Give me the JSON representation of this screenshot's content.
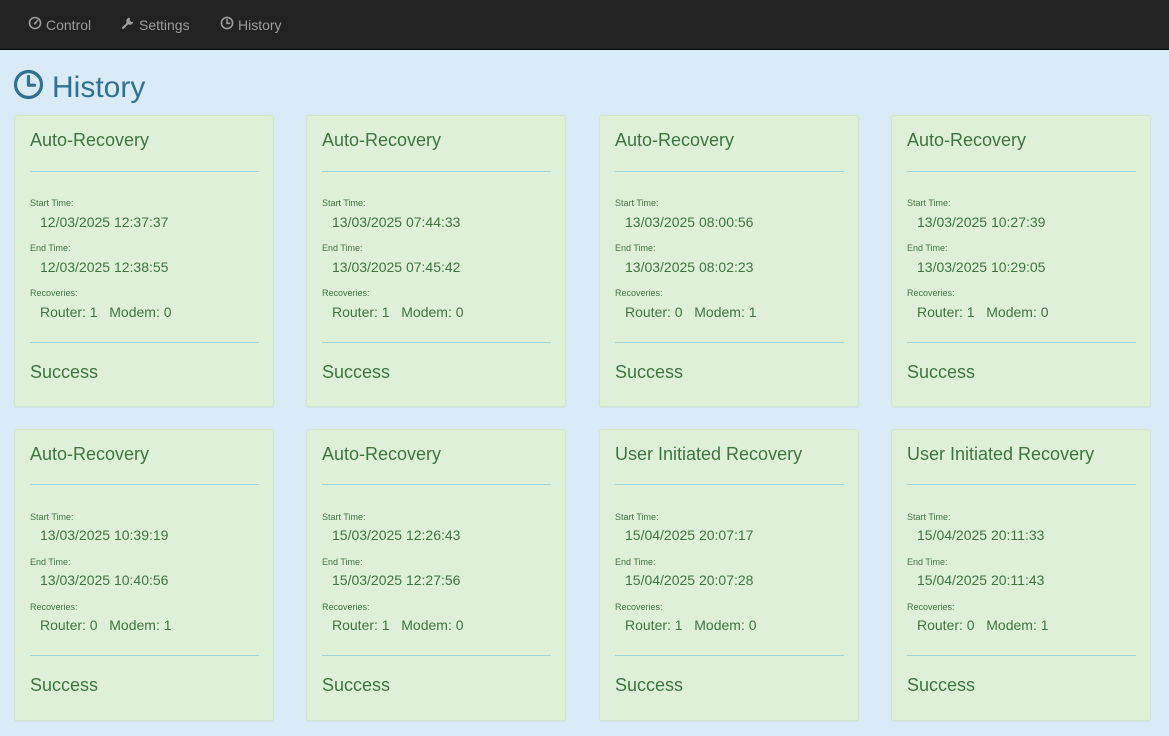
{
  "nav": {
    "items": [
      {
        "label": "Control",
        "icon": "dashboard-icon"
      },
      {
        "label": "Settings",
        "icon": "wrench-icon"
      },
      {
        "label": "History",
        "icon": "clock-icon"
      }
    ]
  },
  "page": {
    "title": "History",
    "title_icon": "clock-icon"
  },
  "labels": {
    "start_time": "Start Time:",
    "end_time": "End Time:",
    "recoveries": "Recoveries:"
  },
  "colors": {
    "navbar_bg": "#222222",
    "nav_text": "#9d9d9d",
    "page_bg": "#d9ebf6",
    "title_color": "#31708f",
    "card_bg": "#dff0d8",
    "card_text": "#3c763d",
    "divider": "#9fd6dc"
  },
  "history": [
    {
      "title": "Auto-Recovery",
      "start": "12/03/2025 12:37:37",
      "end": "12/03/2025 12:38:55",
      "recoveries": "Router: 1   Modem: 0",
      "status": "Success"
    },
    {
      "title": "Auto-Recovery",
      "start": "13/03/2025 07:44:33",
      "end": "13/03/2025 07:45:42",
      "recoveries": "Router: 1   Modem: 0",
      "status": "Success"
    },
    {
      "title": "Auto-Recovery",
      "start": "13/03/2025 08:00:56",
      "end": "13/03/2025 08:02:23",
      "recoveries": "Router: 0   Modem: 1",
      "status": "Success"
    },
    {
      "title": "Auto-Recovery",
      "start": "13/03/2025 10:27:39",
      "end": "13/03/2025 10:29:05",
      "recoveries": "Router: 1   Modem: 0",
      "status": "Success"
    },
    {
      "title": "Auto-Recovery",
      "start": "13/03/2025 10:39:19",
      "end": "13/03/2025 10:40:56",
      "recoveries": "Router: 0   Modem: 1",
      "status": "Success"
    },
    {
      "title": "Auto-Recovery",
      "start": "15/03/2025 12:26:43",
      "end": "15/03/2025 12:27:56",
      "recoveries": "Router: 1   Modem: 0",
      "status": "Success"
    },
    {
      "title": "User Initiated Recovery",
      "start": "15/04/2025 20:07:17",
      "end": "15/04/2025 20:07:28",
      "recoveries": "Router: 1   Modem: 0",
      "status": "Success"
    },
    {
      "title": "User Initiated Recovery",
      "start": "15/04/2025 20:11:33",
      "end": "15/04/2025 20:11:43",
      "recoveries": "Router: 0   Modem: 1",
      "status": "Success"
    }
  ]
}
